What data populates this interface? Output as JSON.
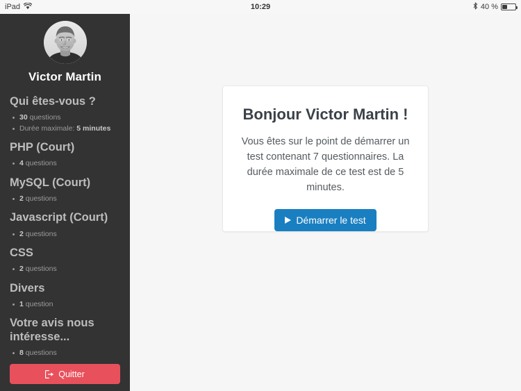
{
  "status_bar": {
    "device": "iPad",
    "wifi_icon": "wifi-icon",
    "time": "10:29",
    "bluetooth_icon": "bluetooth-icon",
    "battery_percent": "40 %",
    "battery_icon": "battery-icon"
  },
  "sidebar": {
    "avatar_icon": "user-avatar-photo",
    "user_name": "Victor Martin",
    "sections": [
      {
        "title": "Qui êtes-vous ?",
        "items": [
          {
            "strong": "30",
            "rest": " questions"
          },
          {
            "prefix": "Durée maximale: ",
            "strong": "5 minutes",
            "rest": ""
          }
        ]
      },
      {
        "title": "PHP (Court)",
        "items": [
          {
            "strong": "4",
            "rest": " questions"
          }
        ]
      },
      {
        "title": "MySQL (Court)",
        "items": [
          {
            "strong": "2",
            "rest": " questions"
          }
        ]
      },
      {
        "title": "Javascript (Court)",
        "items": [
          {
            "strong": "2",
            "rest": " questions"
          }
        ]
      },
      {
        "title": "CSS",
        "items": [
          {
            "strong": "2",
            "rest": " questions"
          }
        ]
      },
      {
        "title": "Divers",
        "items": [
          {
            "strong": "1",
            "rest": " question"
          }
        ]
      },
      {
        "title": "Votre avis nous intéresse...",
        "items": [
          {
            "strong": "8",
            "rest": " questions"
          }
        ]
      }
    ],
    "quit_label": "Quitter",
    "quit_icon": "logout-icon",
    "quit_color": "#e8505c"
  },
  "main": {
    "card": {
      "title": "Bonjour Victor Martin !",
      "text": "Vous êtes sur le point de démarrer un test contenant 7 questionnaires. La durée maximale de ce test est de 5 minutes.",
      "start_label": "Démarrer le test",
      "start_icon": "play-icon",
      "start_color": "#1a7fc1"
    }
  },
  "colors": {
    "sidebar_bg": "#333333",
    "content_bg": "#f6f6f6",
    "card_bg": "#ffffff",
    "accent_blue": "#1a7fc1",
    "accent_red": "#e8505c"
  }
}
